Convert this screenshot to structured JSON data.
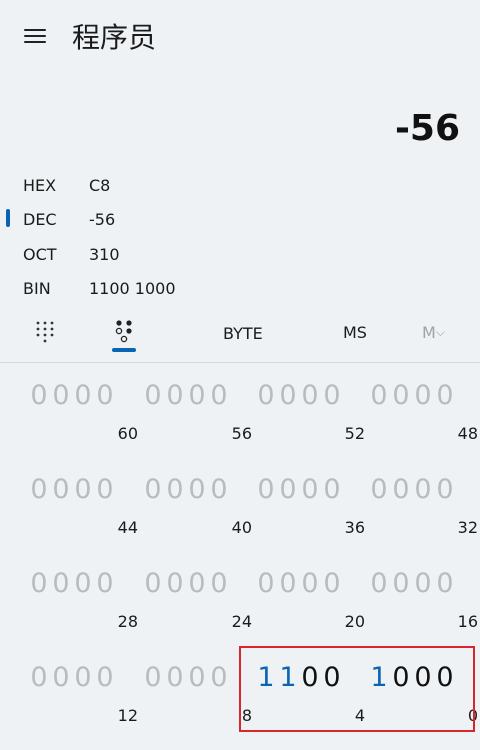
{
  "header": {
    "title": "程序员"
  },
  "display": {
    "value": "-56"
  },
  "radix": [
    {
      "name": "HEX",
      "value": "C8"
    },
    {
      "name": "DEC",
      "value": "-56"
    },
    {
      "name": "OCT",
      "value": "310"
    },
    {
      "name": "BIN",
      "value": "1100 1000"
    }
  ],
  "toolbar": {
    "word_size": "BYTE",
    "memory_store": "MS",
    "memory_dropdown": "M"
  },
  "icons": {
    "menu": "hamburger-icon",
    "keypad": "full-keypad-icon",
    "bits": "bit-toggling-keypad-icon",
    "dropdown": "chevron-down-icon"
  },
  "colors": {
    "accent": "#0a64b4",
    "highlight_border": "#d9262a",
    "inactive_bit": "#b8bcc0"
  },
  "bit_groups": [
    {
      "bits": [
        "0",
        "0",
        "0",
        "0"
      ],
      "position": "60"
    },
    {
      "bits": [
        "0",
        "0",
        "0",
        "0"
      ],
      "position": "56"
    },
    {
      "bits": [
        "0",
        "0",
        "0",
        "0"
      ],
      "position": "52"
    },
    {
      "bits": [
        "0",
        "0",
        "0",
        "0"
      ],
      "position": "48"
    },
    {
      "bits": [
        "0",
        "0",
        "0",
        "0"
      ],
      "position": "44"
    },
    {
      "bits": [
        "0",
        "0",
        "0",
        "0"
      ],
      "position": "40"
    },
    {
      "bits": [
        "0",
        "0",
        "0",
        "0"
      ],
      "position": "36"
    },
    {
      "bits": [
        "0",
        "0",
        "0",
        "0"
      ],
      "position": "32"
    },
    {
      "bits": [
        "0",
        "0",
        "0",
        "0"
      ],
      "position": "28"
    },
    {
      "bits": [
        "0",
        "0",
        "0",
        "0"
      ],
      "position": "24"
    },
    {
      "bits": [
        "0",
        "0",
        "0",
        "0"
      ],
      "position": "20"
    },
    {
      "bits": [
        "0",
        "0",
        "0",
        "0"
      ],
      "position": "16"
    },
    {
      "bits": [
        "0",
        "0",
        "0",
        "0"
      ],
      "position": "12"
    },
    {
      "bits": [
        "0",
        "0",
        "0",
        "0"
      ],
      "position": "8"
    },
    {
      "bits": [
        "1",
        "1",
        "0",
        "0"
      ],
      "position": "4"
    },
    {
      "bits": [
        "1",
        "0",
        "0",
        "0"
      ],
      "position": "0"
    }
  ]
}
